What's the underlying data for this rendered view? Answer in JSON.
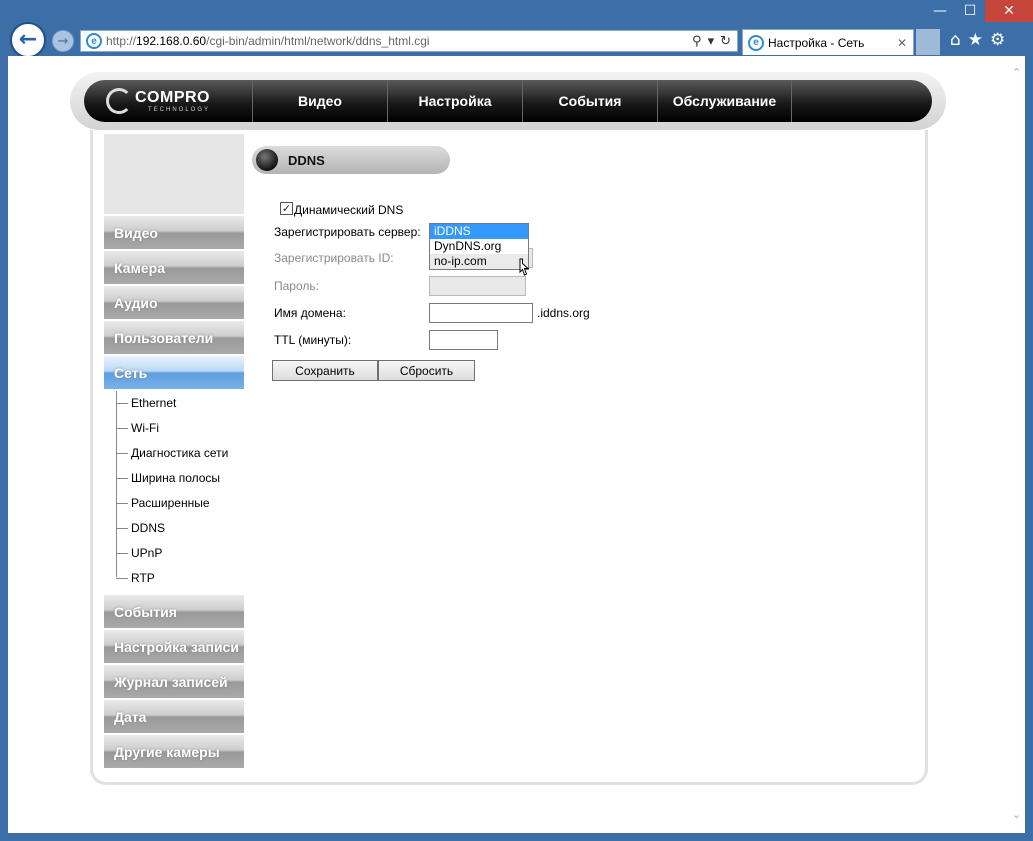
{
  "browser": {
    "window_controls": {
      "minimize": "—",
      "maximize": "☐",
      "close": "✕"
    },
    "address": {
      "prefix": "http://",
      "host": "192.168.0.60",
      "path": "/cgi-bin/admin/html/network/ddns_html.cgi"
    },
    "tab": {
      "title": "Настройка - Сеть"
    },
    "icons": [
      "back-icon",
      "forward-icon",
      "ie-logo-icon",
      "search-icon",
      "refresh-icon",
      "home-icon",
      "favorites-star-icon",
      "settings-gear-icon"
    ]
  },
  "header": {
    "logo": {
      "main": "COMPRO",
      "sub": "TECHNOLOGY"
    },
    "menu": [
      {
        "label": "Видео"
      },
      {
        "label": "Настройка"
      },
      {
        "label": "События"
      },
      {
        "label": "Обслуживание"
      }
    ]
  },
  "sidebar": {
    "items_before": [
      {
        "label": "Видео"
      },
      {
        "label": "Камера"
      },
      {
        "label": "Аудио"
      },
      {
        "label": "Пользователи"
      }
    ],
    "active": {
      "label": "Сеть"
    },
    "subitems": [
      {
        "label": "Ethernet"
      },
      {
        "label": "Wi-Fi"
      },
      {
        "label": "Диагностика сети"
      },
      {
        "label": "Ширина полосы"
      },
      {
        "label": "Расширенные"
      },
      {
        "label": "DDNS"
      },
      {
        "label": "UPnP"
      },
      {
        "label": "RTP"
      }
    ],
    "items_after": [
      {
        "label": "События"
      },
      {
        "label": "Настройка записи"
      },
      {
        "label": "Журнал записей"
      },
      {
        "label": "Дата"
      },
      {
        "label": "Другие камеры"
      }
    ]
  },
  "form": {
    "title": "DDNS",
    "dynamic_dns": {
      "label": "Динамический DNS",
      "checked": true
    },
    "server": {
      "label": "Зарегистрировать сервер:",
      "options": [
        "iDDNS",
        "DynDNS.org",
        "no-ip.com"
      ],
      "selected": "iDDNS",
      "hovered": "no-ip.com"
    },
    "register_id": {
      "label": "Зарегистрировать ID:",
      "value": ""
    },
    "password": {
      "label": "Пароль:",
      "value": ""
    },
    "domain": {
      "label": "Имя домена:",
      "value": "",
      "suffix": ".iddns.org"
    },
    "ttl": {
      "label": "TTL (минуты):",
      "value": ""
    },
    "save_label": "Сохранить",
    "reset_label": "Сбросить"
  }
}
